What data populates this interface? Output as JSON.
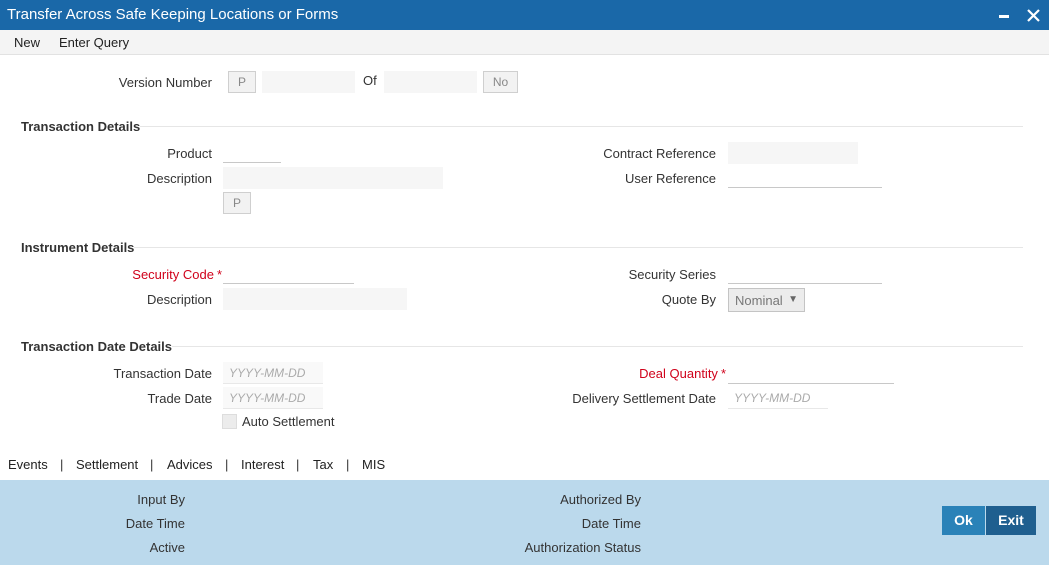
{
  "window": {
    "title": "Transfer Across Safe Keeping Locations or Forms"
  },
  "toolbar": {
    "new_label": "New",
    "enter_query_label": "Enter Query"
  },
  "version": {
    "label": "Version Number",
    "prev_button": "P",
    "current_value": "",
    "of_label": "Of",
    "total_value": "",
    "next_button": "No"
  },
  "transaction_details": {
    "header": "Transaction Details",
    "product_label": "Product",
    "product_value": "",
    "description_label": "Description",
    "description_value": "",
    "p_button": "P",
    "contract_reference_label": "Contract Reference",
    "contract_reference_value": "",
    "user_reference_label": "User Reference",
    "user_reference_value": ""
  },
  "instrument_details": {
    "header": "Instrument Details",
    "security_code_label": "Security Code",
    "security_code_value": "",
    "description_label": "Description",
    "description_value": "",
    "security_series_label": "Security Series",
    "security_series_value": "",
    "quote_by_label": "Quote By",
    "quote_by_value": "Nominal"
  },
  "transaction_date_details": {
    "header": "Transaction Date Details",
    "transaction_date_label": "Transaction Date",
    "transaction_date_placeholder": "YYYY-MM-DD",
    "trade_date_label": "Trade Date",
    "trade_date_placeholder": "YYYY-MM-DD",
    "auto_settlement_label": "Auto Settlement",
    "deal_quantity_label": "Deal Quantity",
    "deal_quantity_value": "",
    "delivery_settlement_date_label": "Delivery Settlement Date",
    "delivery_settlement_date_placeholder": "YYYY-MM-DD"
  },
  "required_marker": "*",
  "tabs": [
    "Events",
    "Settlement",
    "Advices",
    "Interest",
    "Tax",
    "MIS"
  ],
  "tab_separator": "|",
  "footer": {
    "input_by_label": "Input By",
    "date_time_label": "Date Time",
    "active_label": "Active",
    "authorized_by_label": "Authorized By",
    "auth_date_time_label": "Date Time",
    "authorization_status_label": "Authorization Status",
    "ok_label": "Ok",
    "exit_label": "Exit"
  },
  "colors": {
    "titlebar": "#1a68a8",
    "footer": "#bbd9ec",
    "ok_button": "#2a82b8",
    "exit_button": "#1f5f8f",
    "required": "#d0021b"
  }
}
